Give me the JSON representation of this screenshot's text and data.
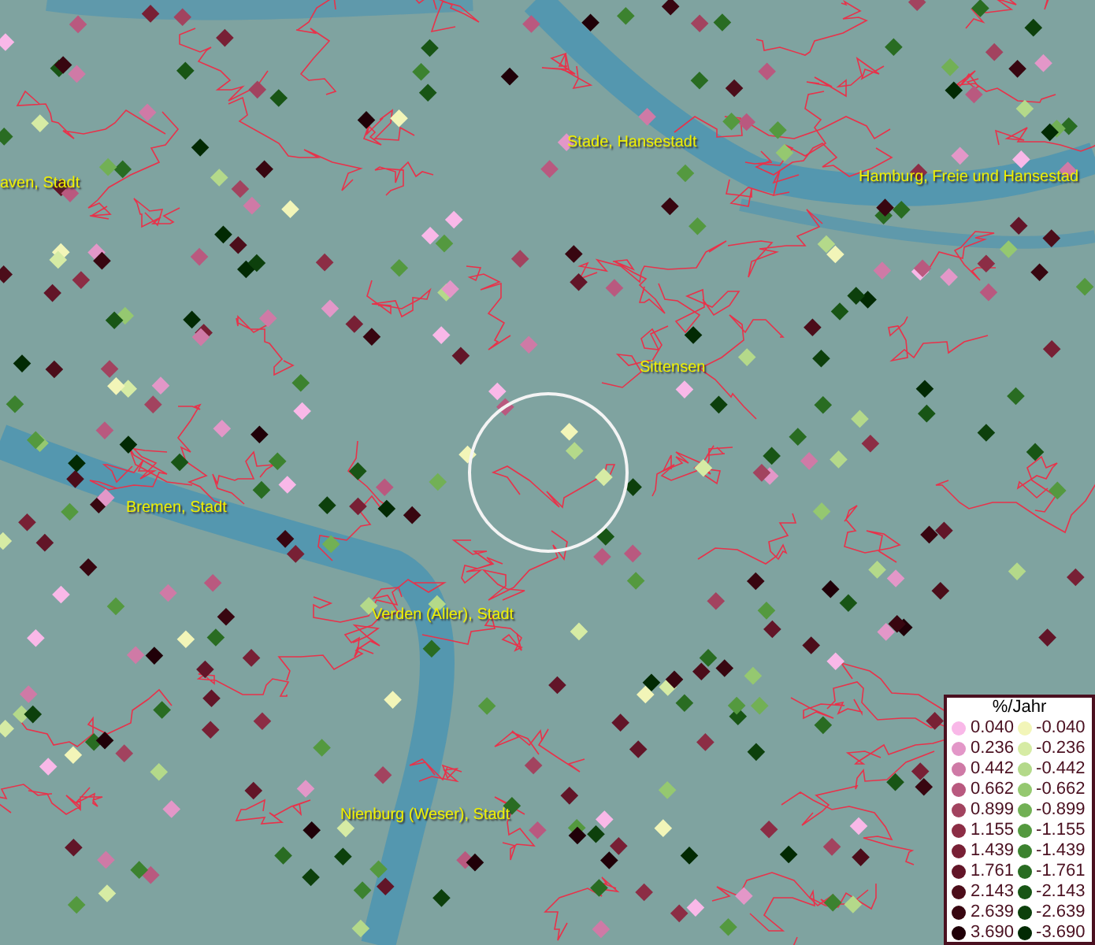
{
  "place_labels": [
    {
      "text": "aven, Stadt"
    },
    {
      "text": "Stade, Hansestadt"
    },
    {
      "text": "Hamburg, Freie und Hansestad"
    },
    {
      "text": "Sittensen"
    },
    {
      "text": "Bremen, Stadt"
    },
    {
      "text": "Verden (Aller), Stadt"
    },
    {
      "text": "Nienburg (Weser), Stadt"
    }
  ],
  "legend": {
    "title": "%/Jahr",
    "positive": [
      {
        "value": "0.040",
        "color": "#f9b8e8"
      },
      {
        "value": "0.236",
        "color": "#e397c8"
      },
      {
        "value": "0.442",
        "color": "#cf7aa6"
      },
      {
        "value": "0.662",
        "color": "#b9597f"
      },
      {
        "value": "0.899",
        "color": "#a2435f"
      },
      {
        "value": "1.155",
        "color": "#8c2d45"
      },
      {
        "value": "1.439",
        "color": "#782035"
      },
      {
        "value": "1.761",
        "color": "#621528"
      },
      {
        "value": "2.143",
        "color": "#4c0d1a"
      },
      {
        "value": "2.639",
        "color": "#380610"
      },
      {
        "value": "3.690",
        "color": "#200008"
      }
    ],
    "negative": [
      {
        "value": "-0.040",
        "color": "#f2f5b8"
      },
      {
        "value": "-0.236",
        "color": "#d6eba4"
      },
      {
        "value": "-0.442",
        "color": "#b4d98a"
      },
      {
        "value": "-0.662",
        "color": "#95c870"
      },
      {
        "value": "-0.899",
        "color": "#72b055"
      },
      {
        "value": "-1.155",
        "color": "#54993f"
      },
      {
        "value": "-1.439",
        "color": "#3c822f"
      },
      {
        "value": "-1.761",
        "color": "#296c22"
      },
      {
        "value": "-2.143",
        "color": "#185515"
      },
      {
        "value": "-2.639",
        "color": "#0d400c"
      },
      {
        "value": "-3.690",
        "color": "#022a03"
      }
    ]
  }
}
